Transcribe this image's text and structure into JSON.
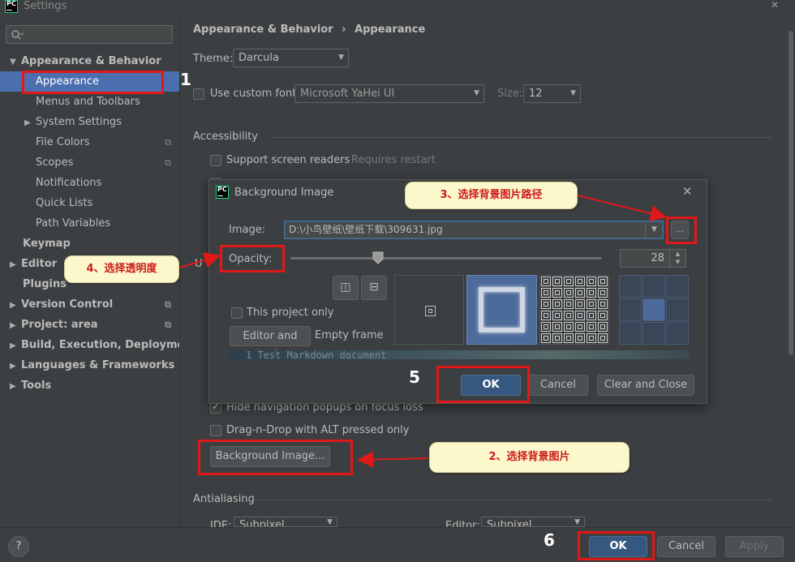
{
  "window": {
    "title": "Settings",
    "close_glyph": "✕"
  },
  "search": {
    "placeholder": ""
  },
  "sidebar": {
    "items": [
      {
        "label": "Appearance & Behavior"
      },
      {
        "label": "Appearance"
      },
      {
        "label": "Menus and Toolbars"
      },
      {
        "label": "System Settings"
      },
      {
        "label": "File Colors"
      },
      {
        "label": "Scopes"
      },
      {
        "label": "Notifications"
      },
      {
        "label": "Quick Lists"
      },
      {
        "label": "Path Variables"
      },
      {
        "label": "Keymap"
      },
      {
        "label": "Editor"
      },
      {
        "label": "Plugins"
      },
      {
        "label": "Version Control"
      },
      {
        "label": "Project: area"
      },
      {
        "label": "Build, Execution, Deployment"
      },
      {
        "label": "Languages & Frameworks"
      },
      {
        "label": "Tools"
      }
    ]
  },
  "breadcrumb": {
    "parent": "Appearance & Behavior",
    "sep": "›",
    "current": "Appearance"
  },
  "appearance": {
    "theme_label": "Theme:",
    "theme_value": "Darcula",
    "custom_font_label": "Use custom font:",
    "font_value": "Microsoft YaHei UI",
    "size_label": "Size:",
    "size_value": "12",
    "accessibility_title": "Accessibility",
    "screen_readers_label": "Support screen readers",
    "requires_restart": "Requires restart",
    "hide_nav_label": "Hide navigation popups on focus loss",
    "drag_drop_label": "Drag-n-Drop with ALT pressed only",
    "background_button": "Background Image...",
    "antialiasing_title": "Antialiasing",
    "ide_label": "IDE:",
    "ide_value": "Subpixel",
    "editor_label": "Editor:",
    "editor_value": "Subpixel",
    "partial_u": "U"
  },
  "dialog": {
    "title": "Background Image",
    "image_label": "Image:",
    "image_path": "D:\\小鸟壁纸\\壁纸下载\\309631.jpg",
    "browse_label": "...",
    "opacity_label": "Opacity:",
    "opacity_value": 28,
    "opacity_text": "28",
    "this_project_only": "This project only",
    "target_editor_tools": "Editor and tools",
    "target_empty_frame": "Empty frame",
    "preview_text": "1  Test Markdown document",
    "ok": "OK",
    "cancel": "Cancel",
    "clear_close": "Clear and Close"
  },
  "footer": {
    "help": "?",
    "ok": "OK",
    "cancel": "Cancel",
    "apply": "Apply"
  },
  "annotations": {
    "n1": "1",
    "n5": "5",
    "n6": "6",
    "callout_2": "2、选择背景图片",
    "callout_3": "3、选择背景图片路径",
    "callout_4": "4、选择透明度"
  },
  "colors": {
    "selection": "#4b6eaf",
    "primary_button": "#365880",
    "annotation_red": "#e01818",
    "callout_bg": "#fcf8cc"
  }
}
